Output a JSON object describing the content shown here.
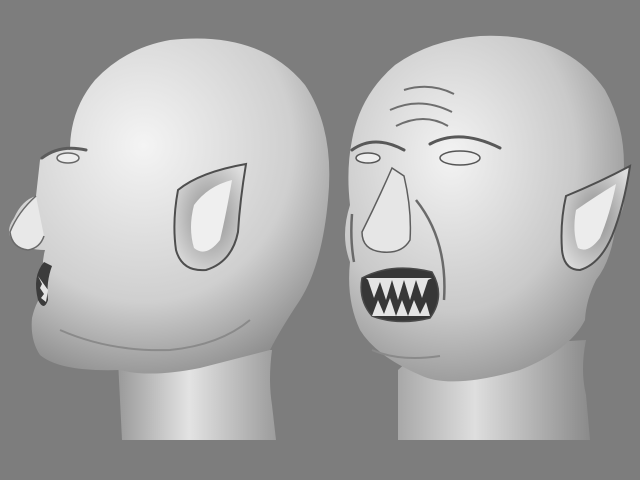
{
  "colors": {
    "background": "#7d7d7d",
    "clay_light": "#f2f2f2",
    "clay_mid": "#bdbdbd",
    "clay_dark": "#5f5f5f",
    "cavity": "#3a3a3a",
    "teeth": "#e6e6e6"
  },
  "views": [
    {
      "id": "side",
      "orientation": "profile-left"
    },
    {
      "id": "front",
      "orientation": "three-quarter-right"
    }
  ]
}
